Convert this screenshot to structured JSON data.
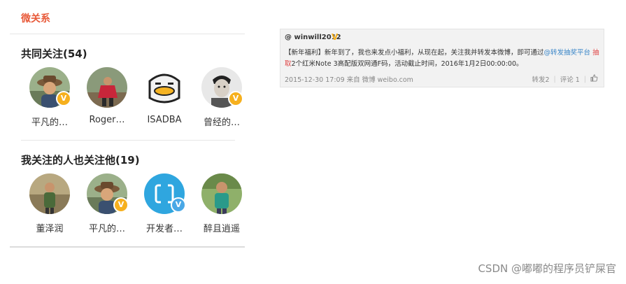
{
  "panel": {
    "title": "微关系",
    "common_section": {
      "title": "共同关注(54)",
      "items": [
        {
          "name": "平凡的…",
          "badge": "V",
          "icon": "avatar-man-hat"
        },
        {
          "name": "Roger…",
          "badge": "",
          "icon": "avatar-outdoor-red"
        },
        {
          "name": "ISADBA",
          "badge": "",
          "icon": "avatar-duck"
        },
        {
          "name": "曾经的…",
          "badge": "V",
          "icon": "avatar-portrait-bw"
        }
      ]
    },
    "also_follow_section": {
      "title": "我关注的人也关注他(19)",
      "items": [
        {
          "name": "董泽润",
          "badge": "",
          "icon": "avatar-person-outdoor"
        },
        {
          "name": "平凡的…",
          "badge": "V",
          "icon": "avatar-man-hat"
        },
        {
          "name": "开发者…",
          "badge": "V",
          "icon": "avatar-blue-square"
        },
        {
          "name": "醉且逍遥",
          "badge": "",
          "icon": "avatar-person-field"
        }
      ]
    }
  },
  "card": {
    "user": "@ winwill2012",
    "vmark": "V",
    "text_prefix": "【新年福利】新年到了，我也来发点小福利，从现在起，关注我并转发本微博，即可通过",
    "link_text": "@转发抽奖平台",
    "red_text": "抽取",
    "text_suffix": "2个红米Note 3高配版双网通F码，活动截止时间，2016年1月2日00:00:00。",
    "meta": "2015-12-30 17:09 来自 微博 weibo.com",
    "repost": "转发2",
    "comment": "评论 1"
  },
  "watermark": "CSDN @嘟嘟的程序员铲屎官",
  "colors": {
    "title_red": "#e85a3a",
    "badge_gold": "#f6b01e",
    "badge_blue": "#4aa8e6",
    "link_blue": "#3a86c8"
  }
}
